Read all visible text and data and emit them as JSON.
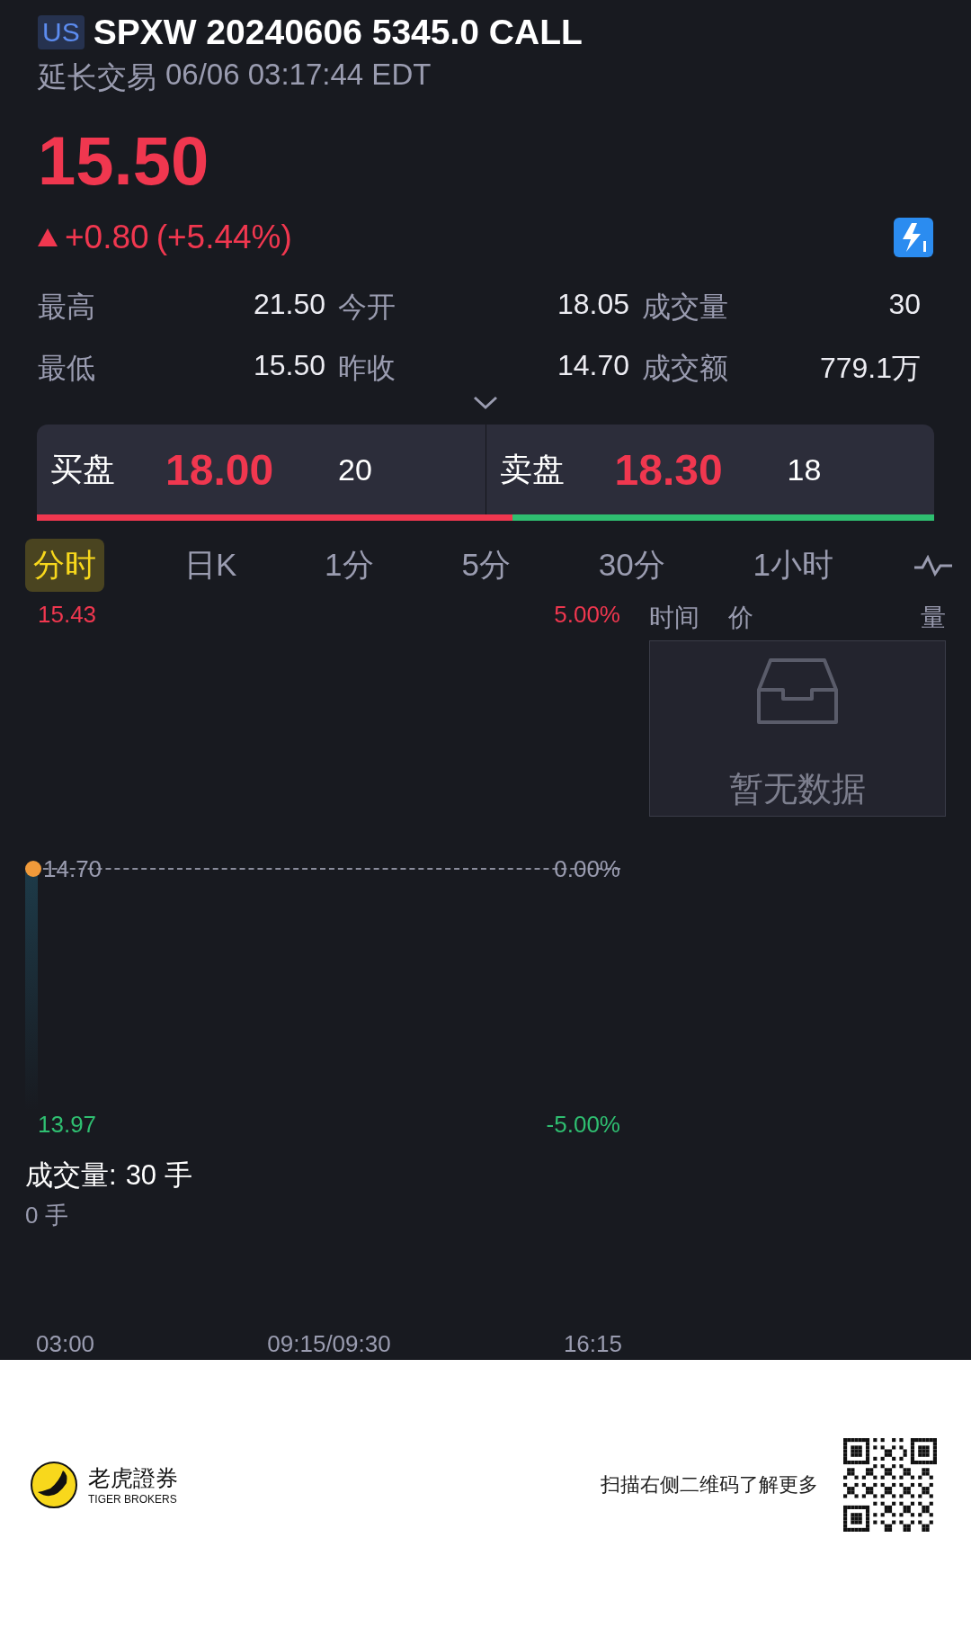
{
  "header": {
    "market_badge": "US",
    "title": "SPXW 20240606 5345.0 CALL",
    "session": "延长交易",
    "timestamp": "06/06 03:17:44 EDT"
  },
  "quote": {
    "price": "15.50",
    "rising": true,
    "change": "+0.80",
    "change_pct": "(+5.44%)"
  },
  "stats": [
    {
      "label": "最高",
      "value": "21.50"
    },
    {
      "label": "今开",
      "value": "18.05"
    },
    {
      "label": "成交量",
      "value": "30"
    },
    {
      "label": "最低",
      "value": "15.50"
    },
    {
      "label": "昨收",
      "value": "14.70"
    },
    {
      "label": "成交额",
      "value": "779.1万"
    }
  ],
  "order_book": {
    "bid": {
      "label": "买盘",
      "price": "18.00",
      "size": "20"
    },
    "ask": {
      "label": "卖盘",
      "price": "18.30",
      "size": "18"
    },
    "level": 0.53
  },
  "periods": [
    {
      "label": "分时",
      "selected": true
    },
    {
      "label": "日K",
      "selected": false
    },
    {
      "label": "1分",
      "selected": false
    },
    {
      "label": "5分",
      "selected": false
    },
    {
      "label": "30分",
      "selected": false
    },
    {
      "label": "1小时",
      "selected": false
    }
  ],
  "chart": {
    "price_high": "15.43",
    "pct_high": "5.00%",
    "price_ref": "14.70",
    "pct_ref": "0.00%",
    "price_low": "13.97",
    "pct_low": "-5.00%",
    "volume_label": "成交量:",
    "volume_value": "30 手",
    "volume_cursor": "0 手",
    "times": [
      "03:00",
      "09:15/09:30",
      "16:15"
    ]
  },
  "trades": {
    "columns": [
      "时间",
      "价",
      "量"
    ],
    "empty_text": "暂无数据"
  },
  "footer": {
    "brand_name": "老虎證券",
    "brand_sub": "TIGER BROKERS",
    "qr_caption": "扫描右侧二维码了解更多"
  }
}
